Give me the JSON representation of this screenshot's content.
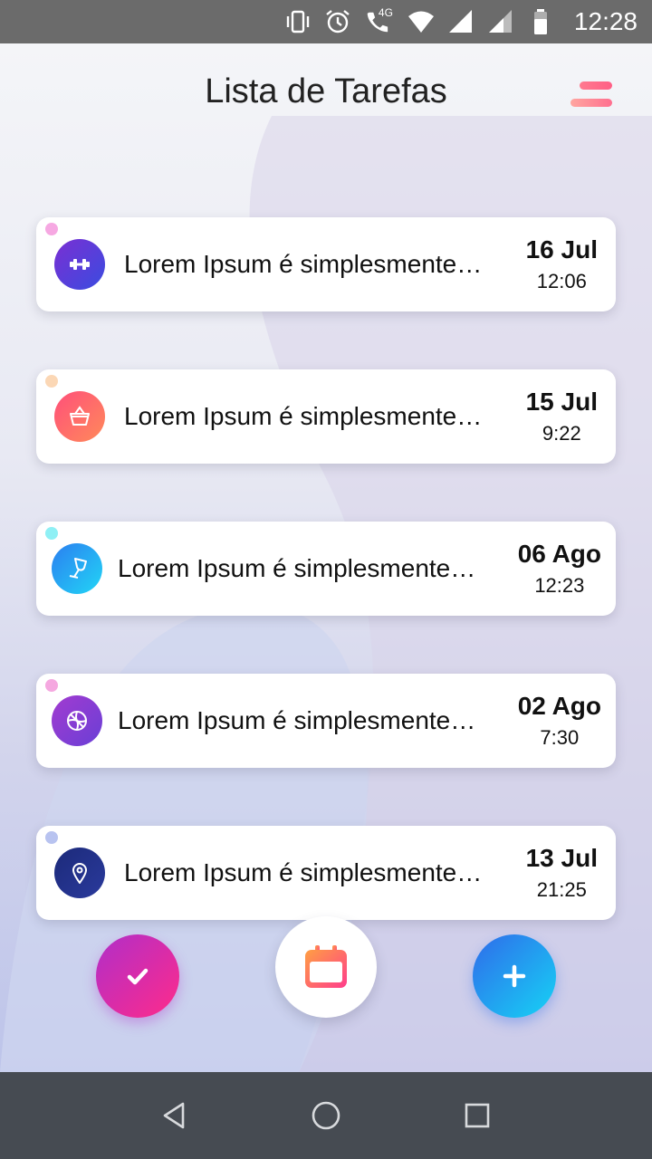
{
  "status_bar": {
    "time": "12:28",
    "network_label": "4G",
    "icons": [
      "vibrate-icon",
      "alarm-icon",
      "call-4g-icon",
      "wifi-icon",
      "signal-icon",
      "signal-icon",
      "battery-icon"
    ]
  },
  "header": {
    "title": "Lista de Tarefas",
    "menu_icon": "menu-icon"
  },
  "tasks": [
    {
      "text": "Lorem Ipsum é simplesmente…",
      "date": "16 Jul",
      "time": "12:06",
      "icon": "dumbbell-icon",
      "dot_color": "#f6a8e2",
      "icon_gradient": [
        "#7a2fd3",
        "#3a4ce0"
      ]
    },
    {
      "text": "Lorem Ipsum é simplesmente…",
      "date": "15 Jul",
      "time": "9:22",
      "icon": "basket-icon",
      "dot_color": "#fbd7b5",
      "icon_gradient": [
        "#ff4f7a",
        "#ff8a5a"
      ]
    },
    {
      "text": "Lorem Ipsum é simplesmente…",
      "date": "06 Ago",
      "time": "12:23",
      "icon": "wine-glass-icon",
      "dot_color": "#8ff0f5",
      "icon_gradient": [
        "#2b7ef0",
        "#22d6f6"
      ]
    },
    {
      "text": "Lorem Ipsum é simplesmente…",
      "date": "02 Ago",
      "time": "7:30",
      "icon": "basketball-icon",
      "dot_color": "#f5a8e0",
      "icon_gradient": [
        "#a23bd0",
        "#6a3fd6"
      ]
    },
    {
      "text": "Lorem Ipsum é simplesmente…",
      "date": "13 Jul",
      "time": "21:25",
      "icon": "location-pin-icon",
      "dot_color": "#b8c3f0",
      "icon_gradient": [
        "#1c2a7a",
        "#2a3a9c"
      ]
    }
  ],
  "fabs": {
    "check": "check-icon",
    "calendar": "calendar-icon",
    "add": "plus-icon"
  },
  "nav": [
    "back-icon",
    "home-icon",
    "recents-icon"
  ]
}
